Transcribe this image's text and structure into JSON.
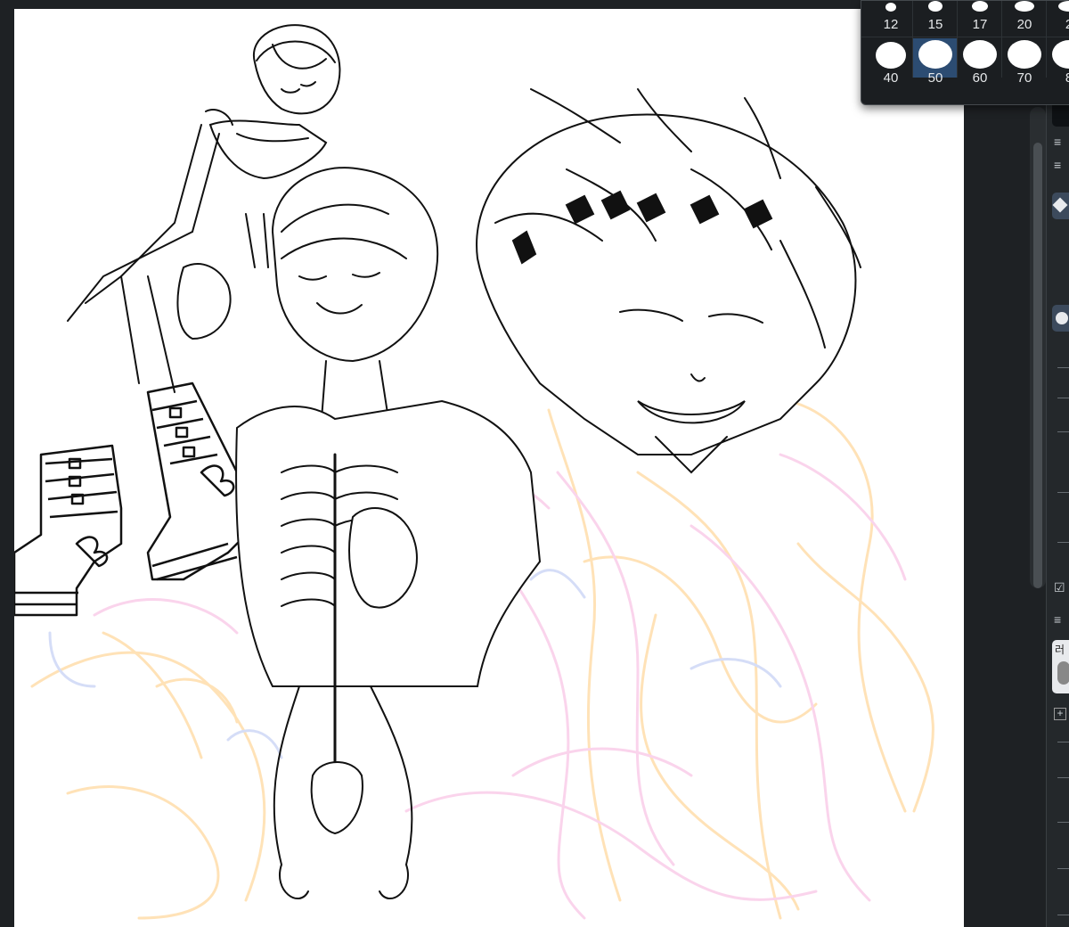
{
  "app": {
    "canvas_background": "#ffffff",
    "workspace_background": "#1e2124",
    "accent": "#2c4c72"
  },
  "brush_size_popup": {
    "row1": [
      "12",
      "15",
      "17",
      "20",
      "2"
    ],
    "row2": [
      "40",
      "50",
      "60",
      "70",
      "8"
    ],
    "selected": "50"
  },
  "right_panel": {
    "label_korean": "러",
    "add_button": "+",
    "icons": [
      "menu-icon",
      "eraser-icon",
      "brush-icon",
      "check-icon",
      "menu-icon",
      "add-icon"
    ]
  }
}
